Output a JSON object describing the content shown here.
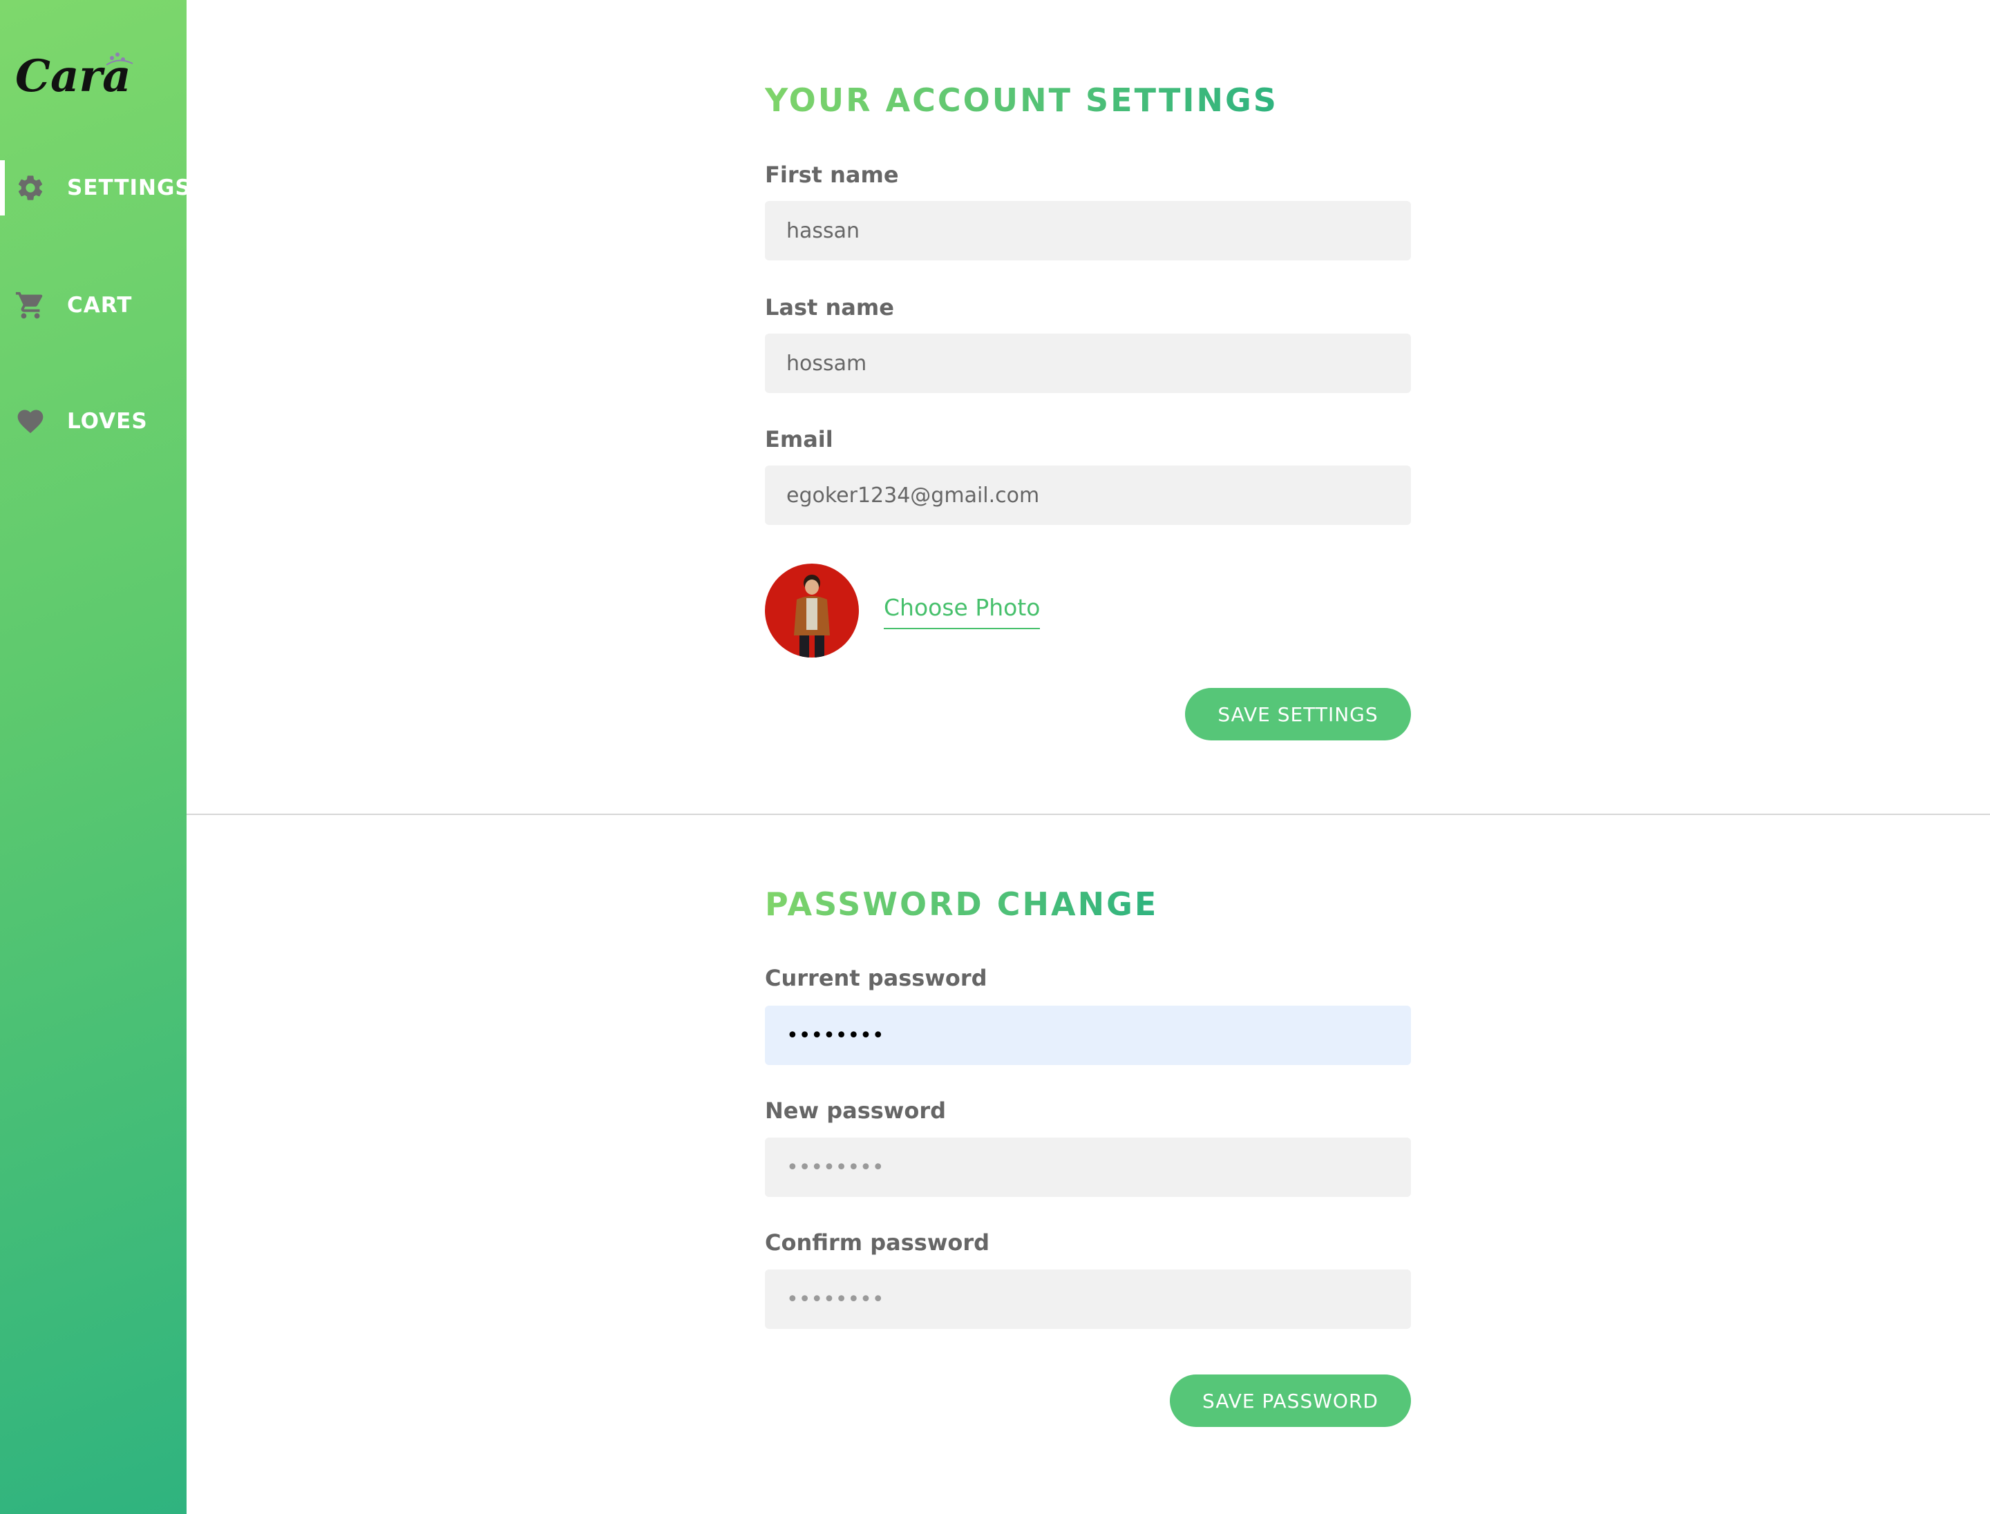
{
  "sidebar": {
    "logo_text": "Cara",
    "items": [
      {
        "label": "SETTINGS",
        "icon": "gear-icon",
        "active": true
      },
      {
        "label": "CART",
        "icon": "cart-icon",
        "active": false
      },
      {
        "label": "LOVES",
        "icon": "heart-icon",
        "active": false
      }
    ]
  },
  "account": {
    "title": "YOUR ACCOUNT SETTINGS",
    "first_name_label": "First name",
    "first_name_value": "hassan",
    "last_name_label": "Last name",
    "last_name_value": "hossam",
    "email_label": "Email",
    "email_value": "egoker1234@gmail.com",
    "choose_photo": "Choose Photo",
    "save_label": "SAVE SETTINGS"
  },
  "password": {
    "title": "PASSWORD CHANGE",
    "current_label": "Current password",
    "current_value": "••••••••",
    "new_label": "New password",
    "new_placeholder": "••••••••",
    "confirm_label": "Confirm password",
    "confirm_placeholder": "••••••••",
    "save_label": "SAVE PASSWORD"
  },
  "colors": {
    "accent": "#56c678",
    "sidebar_start": "#7ed86c",
    "sidebar_end": "#2fb37f",
    "input_bg": "#f1f1f1",
    "input_focused_bg": "#e7f0fd",
    "avatar_bg": "#cc1a10"
  }
}
